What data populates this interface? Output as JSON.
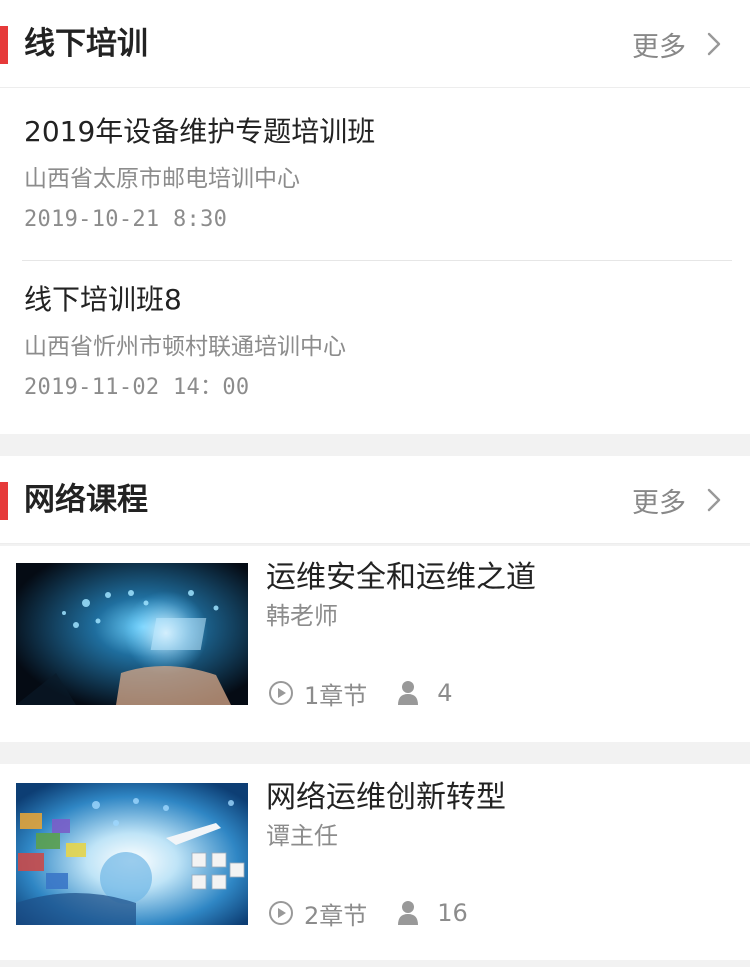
{
  "offline_training": {
    "title": "线下培训",
    "more_label": "更多",
    "items": [
      {
        "title": "2019年设备维护专题培训班",
        "location": "山西省太原市邮电培训中心",
        "time": "2019-10-21 8:30"
      },
      {
        "title": "线下培训班8",
        "location": "山西省忻州市顿村联通培训中心",
        "time": "2019-11-02 14：00"
      }
    ]
  },
  "online_courses": {
    "title": "网络课程",
    "more_label": "更多",
    "items": [
      {
        "title": "运维安全和运维之道",
        "teacher": "韩老师",
        "chapters": "1章节",
        "learners": "4",
        "thumb_icon": "tech-globe-image"
      },
      {
        "title": "网络运维创新转型",
        "teacher": "谭主任",
        "chapters": "2章节",
        "learners": "16",
        "thumb_icon": "network-media-image"
      }
    ]
  },
  "colors": {
    "accent": "#e63a3a",
    "muted": "#8c8c8c",
    "text": "#222222"
  }
}
